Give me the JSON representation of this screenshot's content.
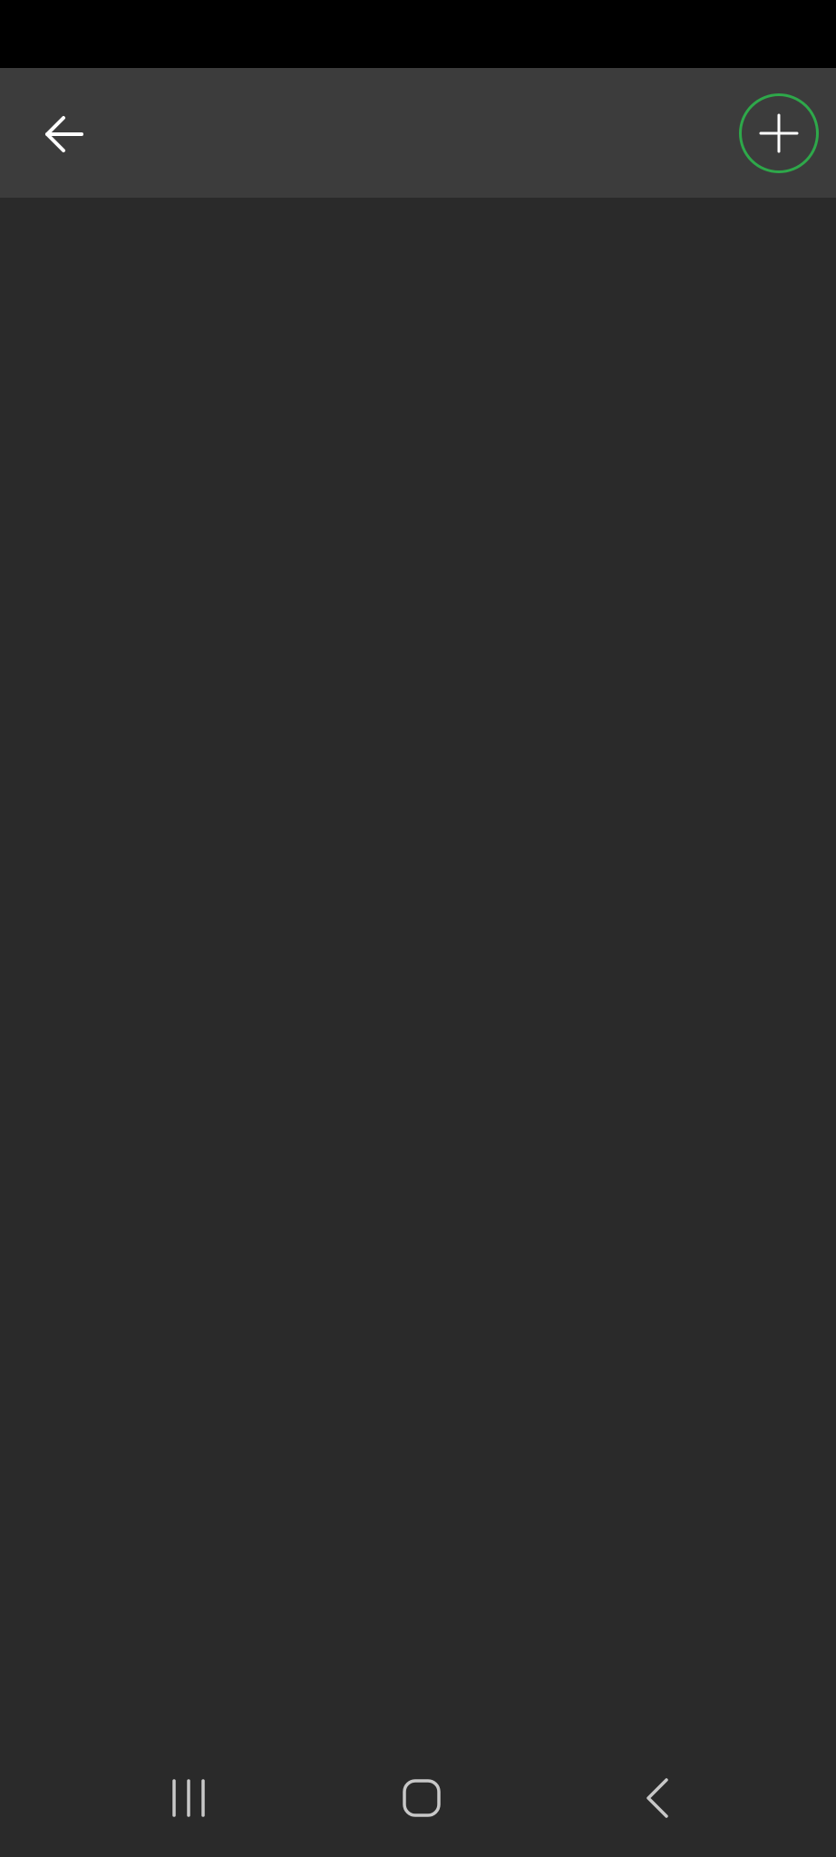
{
  "colors": {
    "status_bar": "#000000",
    "app_bar": "#3c3c3c",
    "background": "#2a2a2a",
    "accent": "#2ea84a",
    "icon": "#ffffff",
    "nav_icon": "#c8c8c8"
  },
  "app_bar": {
    "back_icon": "arrow-left-icon",
    "add_icon": "plus-icon"
  },
  "system_nav": {
    "recents_icon": "recents-icon",
    "home_icon": "home-icon",
    "back_icon": "chevron-left-icon"
  }
}
